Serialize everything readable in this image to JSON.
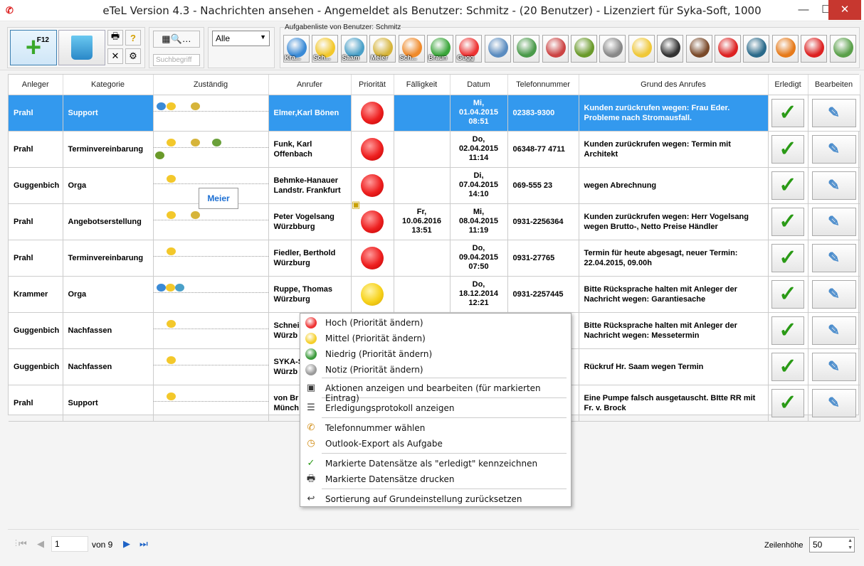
{
  "window": {
    "title": "eTeL Version 4.3 - Nachrichten ansehen - Angemeldet als Benutzer: Schmitz - (20 Benutzer) - Lizenziert für Syka-Soft, 1000",
    "app_icon": "etel-logo-icon",
    "minimize": "—",
    "maximize": "☐",
    "close": "✕"
  },
  "toolbar": {
    "new_label": "F12",
    "filter_select": "Alle",
    "search_placeholder": "Suchbegriff",
    "task_list_label": "Aufgabenliste von Benutzer: Schmitz",
    "task_icons": [
      {
        "label": "Kra...",
        "color": "#3a8ad6"
      },
      {
        "label": "Sch...",
        "color": "#f3c82b"
      },
      {
        "label": "Saam",
        "color": "#4aa0c8"
      },
      {
        "label": "Meier",
        "color": "#d6b43a"
      },
      {
        "label": "Sch...",
        "color": "#f08a2a"
      },
      {
        "label": "Braun",
        "color": "#3aa63a"
      },
      {
        "label": "Gugg",
        "color": "#e33"
      },
      {
        "label": "",
        "color": "#5a8cc0"
      },
      {
        "label": "",
        "color": "#4a9a4a"
      },
      {
        "label": "",
        "color": "#c44"
      },
      {
        "label": "",
        "color": "#6a9a2a"
      },
      {
        "label": "",
        "color": "#888"
      },
      {
        "label": "",
        "color": "#f0c838"
      },
      {
        "label": "",
        "color": "#333"
      },
      {
        "label": "",
        "color": "#7a4a2a"
      },
      {
        "label": "",
        "color": "#d22"
      },
      {
        "label": "",
        "color": "#2a6a8a"
      },
      {
        "label": "",
        "color": "#e67a1a"
      },
      {
        "label": "",
        "color": "#d22"
      },
      {
        "label": "",
        "color": "#5aa04a"
      }
    ]
  },
  "grid": {
    "headers": [
      "Anleger",
      "Kategorie",
      "Zuständig",
      "Anrufer",
      "Priorität",
      "Fälligkeit",
      "Datum",
      "Telefonnummer",
      "Grund des Anrufes",
      "Erledigt",
      "Bearbeiten"
    ],
    "rows": [
      {
        "anleger": "Prahl",
        "kategorie": "Support",
        "anrufer": "Elmer,Karl Bönen",
        "prio": "red",
        "faellig": "",
        "datum": "Mi,\n01.04.2015\n08:51",
        "tel": "02383-9300",
        "grund": "Kunden zurückrufen wegen: Frau Eder. Probleme nach Stromausfall.",
        "selected": true
      },
      {
        "anleger": "Prahl",
        "kategorie": "Terminvereinbarung",
        "anrufer": "Funk, Karl\nOffenbach",
        "prio": "red",
        "faellig": "",
        "datum": "Do,\n02.04.2015\n11:14",
        "tel": "06348-77 4711",
        "grund": "Kunden zurückrufen wegen: Termin mit Architekt",
        "selected": false
      },
      {
        "anleger": "Guggenbich",
        "kategorie": "Orga",
        "anrufer": "Behmke-Hanauer\nLandstr. Frankfurt",
        "prio": "red",
        "faellig": "",
        "datum": "Di,\n07.04.2015\n14:10",
        "tel": "069-555 23",
        "grund": "wegen Abrechnung",
        "selected": false
      },
      {
        "anleger": "Prahl",
        "kategorie": "Angebotserstellung",
        "anrufer": "Peter Vogelsang\nWürzbburg",
        "prio": "red",
        "faellig": "Fr,\n10.06.2016\n13:51",
        "datum": "Mi,\n08.04.2015\n11:19",
        "tel": "0931-2256364",
        "grund": "Kunden zurückrufen wegen: Herr Vogelsang wegen Brutto-, Netto Preise Händler",
        "selected": false
      },
      {
        "anleger": "Prahl",
        "kategorie": "Terminvereinbarung",
        "anrufer": "Fiedler, Berthold\nWürzburg",
        "prio": "red",
        "faellig": "",
        "datum": "Do,\n09.04.2015\n07:50",
        "tel": "0931-27765",
        "grund": "Termin für heute abgesagt, neuer Termin: 22.04.2015, 09.00h",
        "selected": false
      },
      {
        "anleger": "Krammer",
        "kategorie": "Orga",
        "anrufer": "Ruppe, Thomas\nWürzburg",
        "prio": "yellow",
        "faellig": "",
        "datum": "Do,\n18.12.2014\n12:21",
        "tel": "0931-2257445",
        "grund": "Bitte Rücksprache halten mit Anleger der Nachricht wegen: Garantiesache",
        "selected": false
      },
      {
        "anleger": "Guggenbich",
        "kategorie": "Nachfassen",
        "anrufer": "Schnei\nWürzb",
        "prio": "",
        "faellig": "",
        "datum": "",
        "tel": "",
        "grund": "Bitte Rücksprache halten mit Anleger der Nachricht wegen: Messetermin",
        "selected": false
      },
      {
        "anleger": "Guggenbich",
        "kategorie": "Nachfassen",
        "anrufer": "SYKA-S\nWürzb",
        "prio": "",
        "faellig": "",
        "datum": "",
        "tel": "",
        "grund": "Rückruf Hr. Saam wegen Termin",
        "selected": false
      },
      {
        "anleger": "Prahl",
        "kategorie": "Support",
        "anrufer": "von Br\nMünch",
        "prio": "",
        "faellig": "",
        "datum": "",
        "tel": "",
        "grund": "Eine Pumpe falsch ausgetauscht. BItte RR mit Fr. v. Brock",
        "selected": false
      }
    ]
  },
  "tooltip": "Meier",
  "context_menu": [
    {
      "label": "Hoch (Priorität ändern)",
      "icon": "red-dot-icon",
      "color": "#e33"
    },
    {
      "label": "Mittel (Priorität ändern)",
      "icon": "yellow-dot-icon",
      "color": "#f5cf2a"
    },
    {
      "label": "Niedrig (Priorität ändern)",
      "icon": "green-dot-icon",
      "color": "#3a9a3a"
    },
    {
      "label": "Notiz (Priorität ändern)",
      "icon": "gray-dot-icon",
      "color": "#999"
    },
    {
      "label": "Aktionen anzeigen und bearbeiten (für markierten Eintrag)",
      "icon": "actions-icon"
    },
    {
      "label": "Erledigungsprotokoll anzeigen",
      "icon": "protocol-list-icon"
    },
    {
      "label": "Telefonnummer wählen",
      "icon": "phone-icon"
    },
    {
      "label": "Outlook-Export als Aufgabe",
      "icon": "clock-icon"
    },
    {
      "label": "Markierte Datensätze als \"erledigt\" kennzeichnen",
      "icon": "check-icon"
    },
    {
      "label": "Markierte Datensätze drucken",
      "icon": "printer-icon"
    },
    {
      "label": "Sortierung auf Grundeinstellung zurücksetzen",
      "icon": "undo-icon"
    }
  ],
  "pager": {
    "page": "1",
    "of_label": "von 9",
    "row_height_label": "Zeilenhöhe",
    "row_height_value": "50"
  }
}
